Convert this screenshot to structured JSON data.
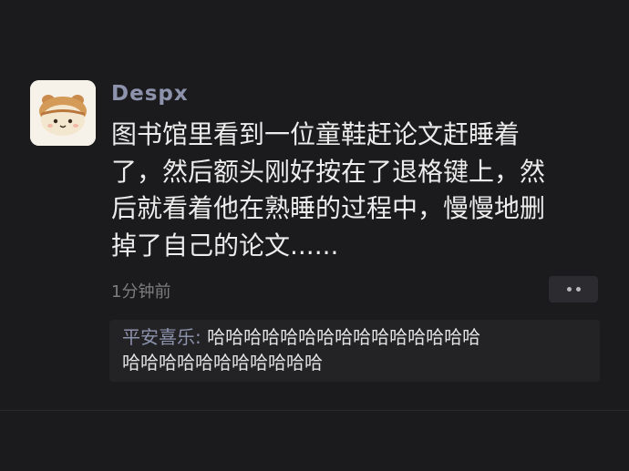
{
  "post": {
    "username": "Despx",
    "text_lines": [
      "图书馆里看到一位童鞋赶论文赶睡着",
      "了，然后额头刚好按在了退格键上，然",
      "后就看着他在熟睡的过程中，慢慢地删",
      "掉了自己的论文......"
    ],
    "timestamp": "1分钟前",
    "avatar_icon": "cat-avatar-icon",
    "more_icon": "more-dots-icon"
  },
  "comments": [
    {
      "author": "平安喜乐",
      "separator": ":",
      "text_line1": " 哈哈哈哈哈哈哈哈哈哈哈哈哈哈哈",
      "text_line2": "哈哈哈哈哈哈哈哈哈哈哈"
    }
  ],
  "colors": {
    "background": "#1b1b1d",
    "username": "#8d93ad",
    "text": "#ececec",
    "timestamp": "#7d7d80",
    "comment_bg": "#232325"
  }
}
